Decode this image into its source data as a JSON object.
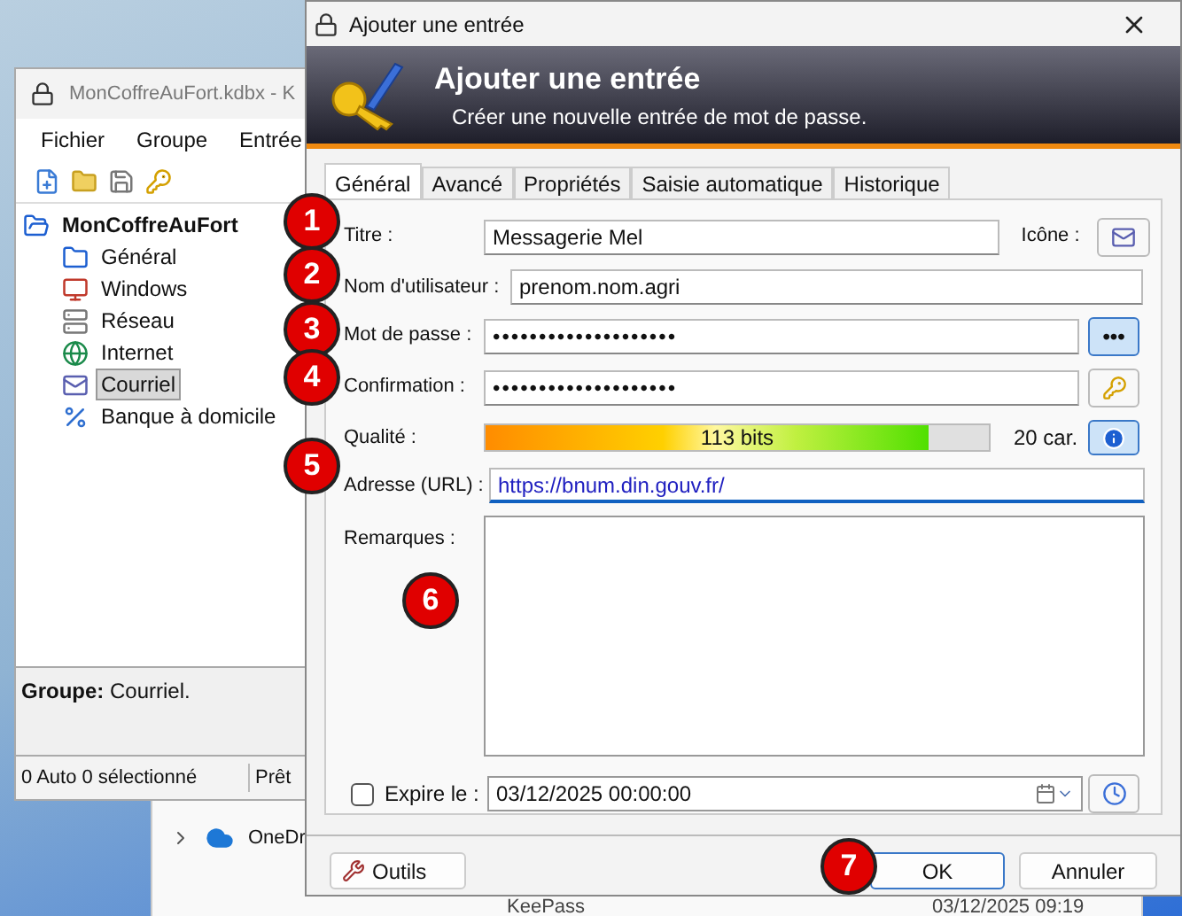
{
  "main_window": {
    "title": "MonCoffreAuFort.kdbx - K",
    "menu": [
      "Fichier",
      "Groupe",
      "Entrée"
    ],
    "tree": {
      "label": "MonCoffreAuFort",
      "selected": false,
      "children": [
        {
          "label": "Général",
          "selected": false
        },
        {
          "label": "Windows",
          "selected": false
        },
        {
          "label": "Réseau",
          "selected": false
        },
        {
          "label": "Internet",
          "selected": false
        },
        {
          "label": "Courriel",
          "selected": true
        },
        {
          "label": "Banque à domicile",
          "selected": false
        }
      ]
    },
    "info": "**Groupe:** Courriel.",
    "status": [
      "0 Auto 0 sélectionné",
      "Prêt"
    ]
  },
  "explorer": {
    "nav_item": "OneDr",
    "file_name": "KeePass",
    "file_date": "03/12/2025 09:19"
  },
  "dialog": {
    "title": "Ajouter une entrée",
    "banner_title": "Ajouter une entrée",
    "banner_subtitle": "Créer une nouvelle entrée de mot de passe.",
    "tabs": [
      {
        "label": "Général",
        "selected": true
      },
      {
        "label": "Avancé",
        "selected": false
      },
      {
        "label": "Propriétés",
        "selected": false
      },
      {
        "label": "Saisie automatique",
        "selected": false
      },
      {
        "label": "Historique",
        "selected": false
      }
    ],
    "title_label": "Titre :",
    "title_value": "Messagerie Mel",
    "icon_label": "Icône :",
    "username_label": "Nom d'utilisateur :",
    "username_value": "prenom.nom.agri",
    "password_label": "Mot de passe :",
    "password_value": "••••••••••••••••••••",
    "show_password": "•••",
    "confirm_label": "Confirmation :",
    "confirm_value": "••••••••••••••••••••",
    "quality_label": "Qualité :",
    "quality": {
      "level": 0.88,
      "reading": "113 bits"
    },
    "length": "20 car.",
    "url_label": "Adresse (URL) :",
    "url_value": "https://bnum.din.gouv.fr/",
    "notes_label": "Remarques :",
    "expiry": {
      "checked": false,
      "label": "Expire le :",
      "value": "03/12/2025 00:00:00"
    },
    "buttons": {
      "tools": "Outils",
      "ok": "OK",
      "cancel": "Annuler"
    }
  },
  "markers": [
    "1",
    "2",
    "3",
    "4",
    "5",
    "6",
    "7"
  ]
}
